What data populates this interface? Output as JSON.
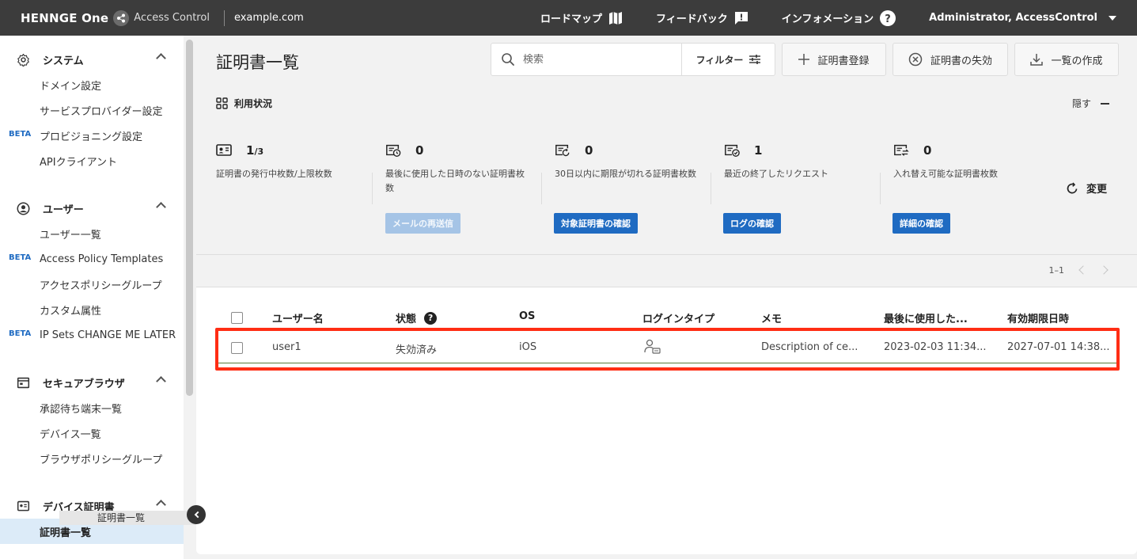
{
  "topbar": {
    "brand": "HENNGE One",
    "product": "Access Control",
    "domain": "example.com",
    "roadmap": "ロードマップ",
    "feedback": "フィードバック",
    "information": "インフォメーション",
    "user": "Administrator, AccessControl"
  },
  "sidebar": {
    "system": {
      "title": "システム",
      "items": [
        {
          "label": "ドメイン設定",
          "beta": ""
        },
        {
          "label": "サービスプロバイダー設定",
          "beta": ""
        },
        {
          "label": "プロビジョニング設定",
          "beta": "BETA"
        },
        {
          "label": "APIクライアント",
          "beta": ""
        }
      ]
    },
    "users": {
      "title": "ユーザー",
      "items": [
        {
          "label": "ユーザー一覧",
          "beta": ""
        },
        {
          "label": "Access Policy Templates",
          "beta": "BETA"
        },
        {
          "label": "アクセスポリシーグループ",
          "beta": ""
        },
        {
          "label": "カスタム属性",
          "beta": ""
        },
        {
          "label": "IP Sets CHANGE ME LATER",
          "beta": "BETA"
        }
      ]
    },
    "browser": {
      "title": "セキュアブラウザ",
      "items": [
        {
          "label": "承認待ち端末一覧",
          "beta": ""
        },
        {
          "label": "デバイス一覧",
          "beta": ""
        },
        {
          "label": "ブラウザポリシーグループ",
          "beta": ""
        }
      ]
    },
    "certs": {
      "title": "デバイス証明書",
      "items": [
        {
          "label": "証明書一覧",
          "beta": ""
        }
      ]
    },
    "overflow_label": "証明書一覧"
  },
  "main": {
    "title": "証明書一覧",
    "search_placeholder": "検索",
    "filter_label": "フィルター",
    "register_label": "証明書登録",
    "revoke_label": "証明書の失効",
    "export_label": "一覧の作成",
    "usage_title": "利用状況",
    "hide_label": "隠す",
    "refresh_label": "変更"
  },
  "stats": [
    {
      "value": "1",
      "limit": "/3",
      "desc": "証明書の発行中枚数/上限枚数",
      "button": ""
    },
    {
      "value": "0",
      "limit": "",
      "desc": "最後に使用した日時のない証明書枚数",
      "button": "メールの再送信"
    },
    {
      "value": "0",
      "limit": "",
      "desc": "30日以内に期限が切れる証明書枚数",
      "button": "対象証明書の確認"
    },
    {
      "value": "1",
      "limit": "",
      "desc": "最近の終了したリクエスト",
      "button": "ログの確認"
    },
    {
      "value": "0",
      "limit": "",
      "desc": "入れ替え可能な証明書枚数",
      "button": "詳細の確認"
    }
  ],
  "pager": {
    "range": "1–1"
  },
  "table": {
    "headers": [
      "ユーザー名",
      "状態",
      "OS",
      "ログインタイプ",
      "メモ",
      "最後に使用した...",
      "有効期限日時"
    ],
    "rows": [
      {
        "user": "user1",
        "status": "失効済み",
        "os": "iOS",
        "login_icon": "user-cert-icon",
        "memo": "Description of ce...",
        "last_used": "2023-02-03 11:34...",
        "expires": "2027-07-01 14:38..."
      }
    ]
  },
  "colors": {
    "topbar": "#3c3c3c",
    "accent": "#1f6bc2",
    "highlight": "#ff2d14"
  }
}
